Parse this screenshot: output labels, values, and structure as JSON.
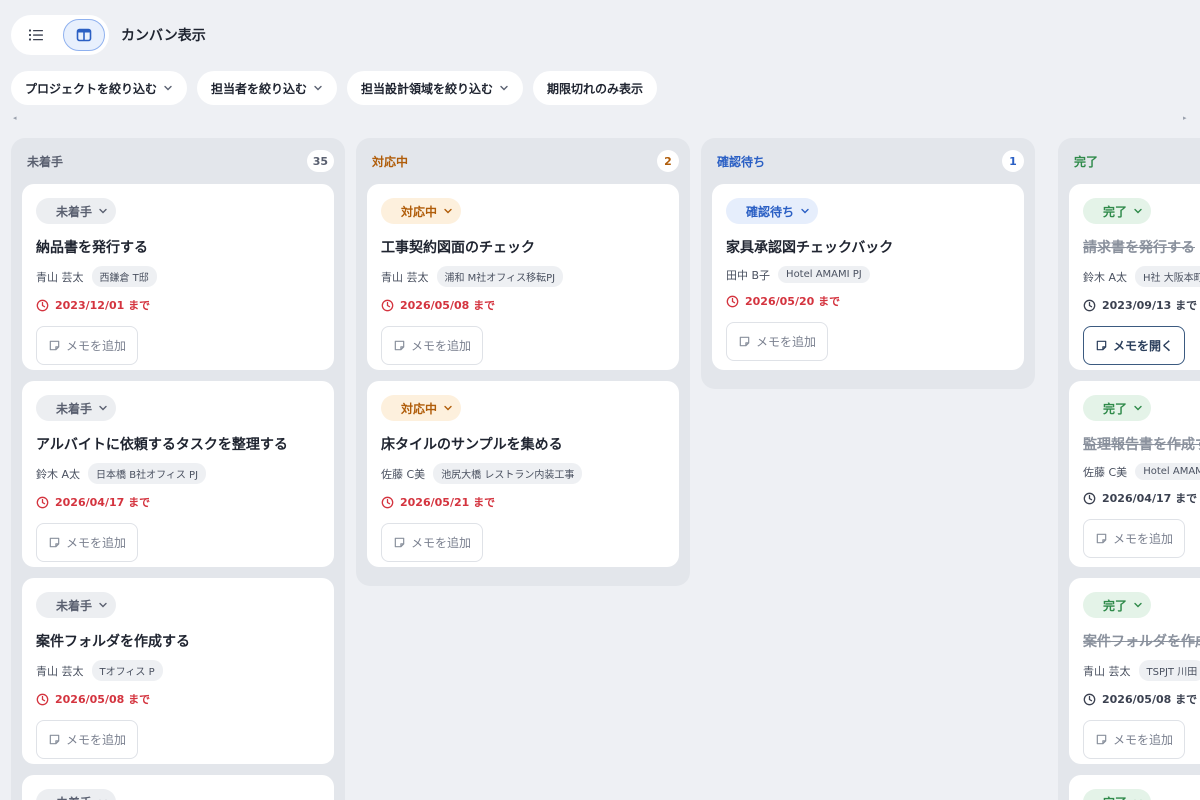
{
  "header": {
    "view_title": "カンバン表示"
  },
  "filters": [
    {
      "label": "プロジェクトを絞り込む",
      "has_dropdown": true
    },
    {
      "label": "担当者を絞り込む",
      "has_dropdown": true
    },
    {
      "label": "担当設計領域を絞り込む",
      "has_dropdown": true
    },
    {
      "label": "期限切れのみ表示",
      "has_dropdown": false
    }
  ],
  "scroll": {
    "left": "◂",
    "right": "▸"
  },
  "memo": {
    "add": "メモを追加",
    "open": "メモを開く"
  },
  "colors": {
    "todo": "#5a6070",
    "todo_bg": "#eceef1",
    "doing": "#b05d0a",
    "doing_bg": "#fdf0dd",
    "review": "#2a5fc4",
    "review_bg": "#e6eefc",
    "done": "#2f8a4a",
    "done_bg": "#e4f3e8",
    "overdue": "#d4343f"
  },
  "columns": [
    {
      "title": "未着手",
      "count": "35",
      "status": "todo",
      "cards": [
        {
          "status": "未着手",
          "title": "納品書を発行する",
          "assignee": "青山 芸太",
          "project": "西鎌倉 T邸",
          "due": "2023/12/01 まで",
          "memo": "add"
        },
        {
          "status": "未着手",
          "title": "アルバイトに依頼するタスクを整理する",
          "assignee": "鈴木 A太",
          "project": "日本橋 B社オフィス PJ",
          "due": "2026/04/17 まで",
          "memo": "add"
        },
        {
          "status": "未着手",
          "title": "案件フォルダを作成する",
          "assignee": "青山 芸太",
          "project": "Tオフィス P",
          "due": "2026/05/08 まで",
          "memo": "add"
        },
        {
          "status": "未着手",
          "partial": true
        }
      ]
    },
    {
      "title": "対応中",
      "count": "2",
      "status": "doing",
      "cards": [
        {
          "status": "対応中",
          "title": "工事契約図面のチェック",
          "assignee": "青山 芸太",
          "project": "浦和 M社オフィス移転PJ",
          "due": "2026/05/08 まで",
          "memo": "add"
        },
        {
          "status": "対応中",
          "title": "床タイルのサンプルを集める",
          "assignee": "佐藤 C美",
          "project": "池尻大橋 レストラン内装工事",
          "due": "2026/05/21 まで",
          "memo": "add"
        }
      ]
    },
    {
      "title": "確認待ち",
      "count": "1",
      "status": "review",
      "cards": [
        {
          "status": "確認待ち",
          "title": "家具承認図チェックバック",
          "assignee": "田中 B子",
          "project": "Hotel AMAMI PJ",
          "due": "2026/05/20 まで",
          "memo": "add"
        }
      ]
    },
    {
      "title": "完了",
      "count": "",
      "status": "done",
      "cards": [
        {
          "status": "完了",
          "title": "請求書を発行する",
          "assignee": "鈴木 A太",
          "project": "H社 大阪本町",
          "due": "2023/09/13 まで",
          "memo": "open"
        },
        {
          "status": "完了",
          "title": "監理報告書を作成する",
          "assignee": "佐藤 C美",
          "project": "Hotel AMAMI",
          "due": "2026/04/17 まで",
          "memo": "add"
        },
        {
          "status": "完了",
          "title": "案件フォルダを作成する",
          "assignee": "青山 芸太",
          "project": "TSPJT 川田",
          "due": "2026/05/08 まで",
          "memo": "add"
        },
        {
          "status": "完了",
          "partial": true
        }
      ]
    }
  ]
}
